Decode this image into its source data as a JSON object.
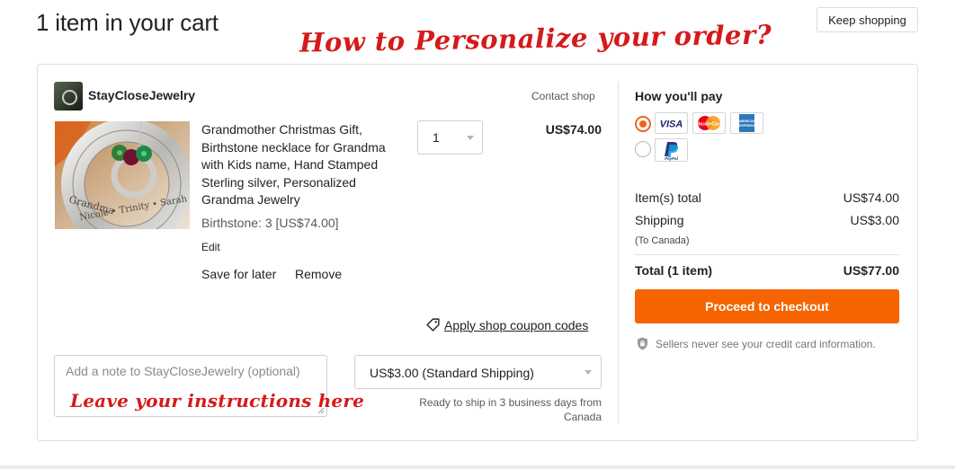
{
  "header": {
    "title": "1 item in your cart",
    "keep_shopping_label": "Keep shopping"
  },
  "annotations": {
    "heading": "How to Personalize your order?",
    "note_hint": "Leave your instructions here"
  },
  "shop": {
    "name": "StayCloseJewelry",
    "contact_label": "Contact shop"
  },
  "item": {
    "title": "Grandmother Christmas Gift, Birthstone necklace for Grandma with Kids name, Hand Stamped Sterling silver, Personalized Grandma Jewelry",
    "variation": "Birthstone: 3 [US$74.00]",
    "edit_label": "Edit",
    "save_for_later_label": "Save for later",
    "remove_label": "Remove",
    "quantity": "1",
    "price": "US$74.00",
    "image_engraving": {
      "line1": "Grandma",
      "line2": "Nicole • Trinity • Sarah"
    }
  },
  "coupon": {
    "label": "Apply shop coupon codes",
    "icon": "tag-icon"
  },
  "note": {
    "placeholder": "Add a note to StayCloseJewelry (optional)"
  },
  "shipping": {
    "selected": "US$3.00 (Standard Shipping)",
    "ready_note": "Ready to ship in 3 business days from Canada"
  },
  "payment": {
    "heading": "How you'll pay",
    "options": [
      {
        "id": "cards",
        "selected": true,
        "logos": [
          "visa",
          "mastercard",
          "amex"
        ]
      },
      {
        "id": "paypal",
        "selected": false,
        "logos": [
          "paypal"
        ]
      }
    ],
    "logo_text": {
      "visa": "VISA",
      "mastercard": "MasterCard",
      "amex_line1": "AMERICAN",
      "amex_line2": "EXPRESS",
      "paypal": "PayPal"
    }
  },
  "summary": {
    "items_total_label": "Item(s) total",
    "items_total_value": "US$74.00",
    "shipping_label": "Shipping",
    "shipping_value": "US$3.00",
    "shipping_destination": "(To Canada)",
    "total_label": "Total (1 item)",
    "total_value": "US$77.00"
  },
  "checkout": {
    "label": "Proceed to checkout",
    "secure_note": "Sellers never see your credit card information."
  },
  "colors": {
    "accent": "#f56400",
    "radio_selected": "#f1641e",
    "annotation_red": "#d51a1a",
    "visa_blue": "#1a1f71",
    "amex_blue": "#2e77bb"
  }
}
